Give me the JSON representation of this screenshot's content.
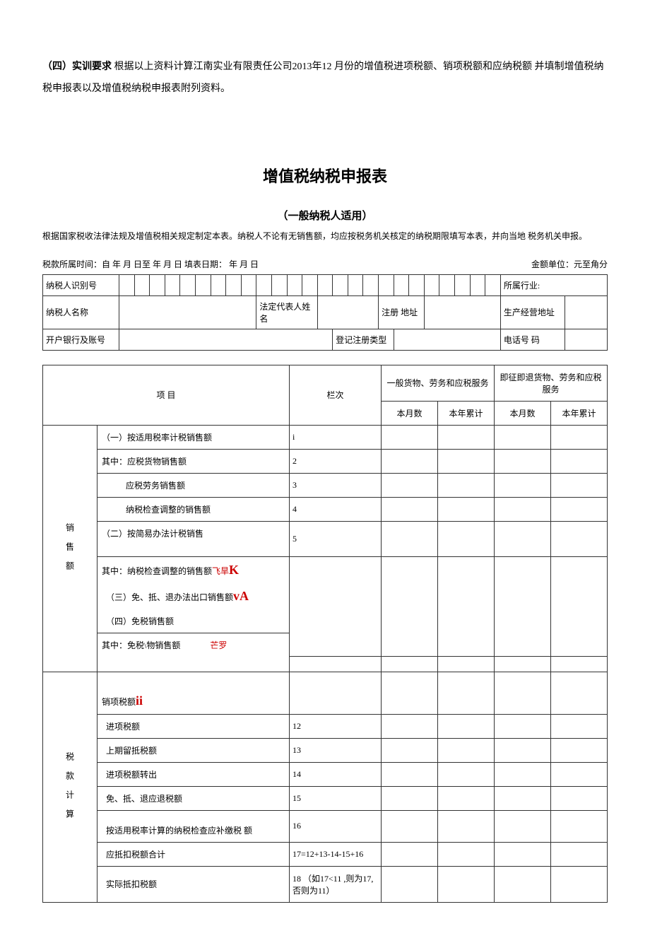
{
  "intro": {
    "label": "（四）实训要求",
    "text1": " 根据以上资料计算江南实业有限责任公司2013年12 月份的增值税进项税额、销项税额和应纳税额  并填制增值税纳税申报表以及增值税纳税申报表附列资料。"
  },
  "title": "增值税纳税申报表",
  "subtitle": "（一般纳税人适用）",
  "note": "根据国家税收法律法规及增值税相关规定制定本表。纳税人不论有无销售额，均应按税务机关核定的纳税期限填写本表，并向当地 税务机关申报。",
  "period": {
    "left": "税款所属时间：自 年 月 日至 年 月 日 填表日期：  年 月 日",
    "right": "金额单位：元至角分"
  },
  "info": {
    "id_label": "纳税人识别号",
    "industry_label": "所属行业:",
    "name_label": "纳税人名称",
    "legal_rep_label": "法定代表人姓名",
    "reg_addr_label": "注册 地址",
    "biz_addr_label": "生产经营地址",
    "bank_label": "开户银行及账号",
    "reg_type_label": "登记注册类型",
    "phone_label": "电话号 码"
  },
  "main": {
    "header": {
      "proj": "项      目",
      "lanci": "栏次",
      "group1": "一般货物、劳务和应税服务",
      "group2": "即征即退货物、劳务和应税服务",
      "month": "本月数",
      "year": "本年累计"
    },
    "sections": {
      "sales": "销 售 额",
      "tax": "税 款 计 算"
    },
    "rows": {
      "r1": {
        "label": "（一）按适用税率计税销售额",
        "lanci": "i"
      },
      "r2": {
        "label": "其中：应税货物销售额",
        "lanci": "2"
      },
      "r3": {
        "label": "应税劳务销售额",
        "lanci": "3"
      },
      "r4": {
        "label": "纳税检查调整的销售额",
        "lanci": "4"
      },
      "r5": {
        "label": "（二）按简易办法计税销售",
        "lanci": "5"
      },
      "r6": {
        "label": "其中：纳税检查调整的销售额",
        "red": "飞旱",
        "bigred": "K"
      },
      "r7": {
        "label": "（三）免、抵、退办法出口销售额",
        "bigred": "vA"
      },
      "r8": {
        "label": "（四）免税销售额"
      },
      "r9": {
        "label": "其中：免税\\物销售额",
        "red": "芒罗"
      },
      "r11": {
        "label": "销项税额",
        "bigred": "ii"
      },
      "r12": {
        "label": "进项税额",
        "lanci": "12"
      },
      "r13": {
        "label": "上期留抵税额",
        "lanci": "13"
      },
      "r14": {
        "label": "进项税额转出",
        "lanci": "14"
      },
      "r15": {
        "label": "免、抵、退应退税额",
        "lanci": "15"
      },
      "r16": {
        "label": "按适用税率计算的纳税检查应补缴税  额",
        "lanci": "16"
      },
      "r17": {
        "label": "应抵扣税额合计",
        "lanci": "17=12+13-14-15+16"
      },
      "r18": {
        "label": "实际抵扣税额",
        "lanci": "18 （如17<11 ,则为17,否则为11）"
      }
    }
  }
}
